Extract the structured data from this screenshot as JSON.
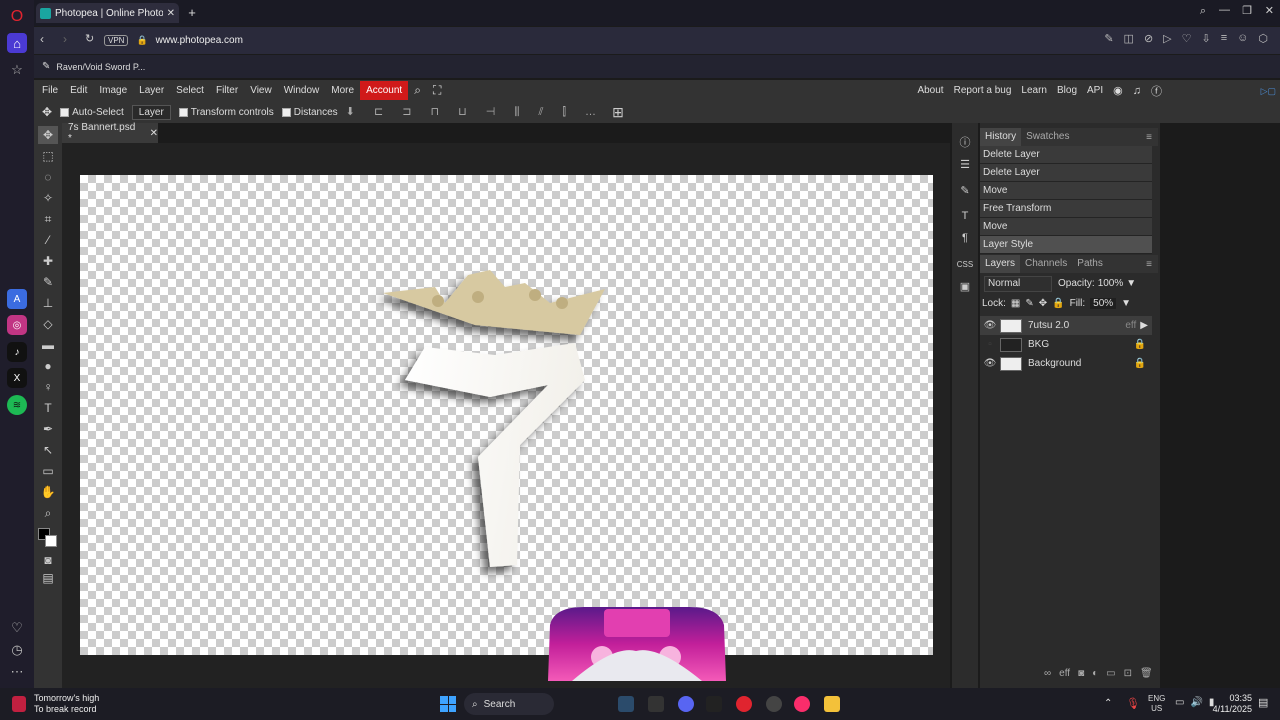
{
  "browser": {
    "tab_title": "Photopea | Online Photo E",
    "new_tab": "+",
    "vpn": "VPN",
    "url": "www.photopea.com",
    "bookmark": "Raven/Void Sword P..."
  },
  "menu": {
    "items": [
      "File",
      "Edit",
      "Image",
      "Layer",
      "Select",
      "Filter",
      "View",
      "Window",
      "More"
    ],
    "account": "Account",
    "right": [
      "About",
      "Report a bug",
      "Learn",
      "Blog",
      "API"
    ]
  },
  "options": {
    "auto_select": "Auto-Select",
    "target": "Layer",
    "transform": "Transform controls",
    "distances": "Distances"
  },
  "document": {
    "tab": "7s Bannert.psd *"
  },
  "history": {
    "tabs": [
      "History",
      "Swatches"
    ],
    "items": [
      "Delete Layer",
      "Delete Layer",
      "Move",
      "Free Transform",
      "Move",
      "Layer Style"
    ]
  },
  "layers": {
    "tabs": [
      "Layers",
      "Channels",
      "Paths"
    ],
    "blend": "Normal",
    "opacity_label": "Opacity:",
    "opacity": "100%",
    "lock_label": "Lock:",
    "fill_label": "Fill:",
    "fill": "50%",
    "list": [
      {
        "name": "7utsu 2.0",
        "visible": true,
        "eff": "eff"
      },
      {
        "name": "BKG",
        "visible": false
      },
      {
        "name": "Background",
        "visible": true
      }
    ]
  },
  "taskbar": {
    "weather_line1": "Tomorrow's high",
    "weather_line2": "To break record",
    "search": "Search",
    "lang1": "ENG",
    "lang2": "US",
    "time": "03:35",
    "date": "4/11/2025"
  },
  "colors": {
    "accent": "#d01a1a",
    "brand": "#1aa5a0"
  }
}
